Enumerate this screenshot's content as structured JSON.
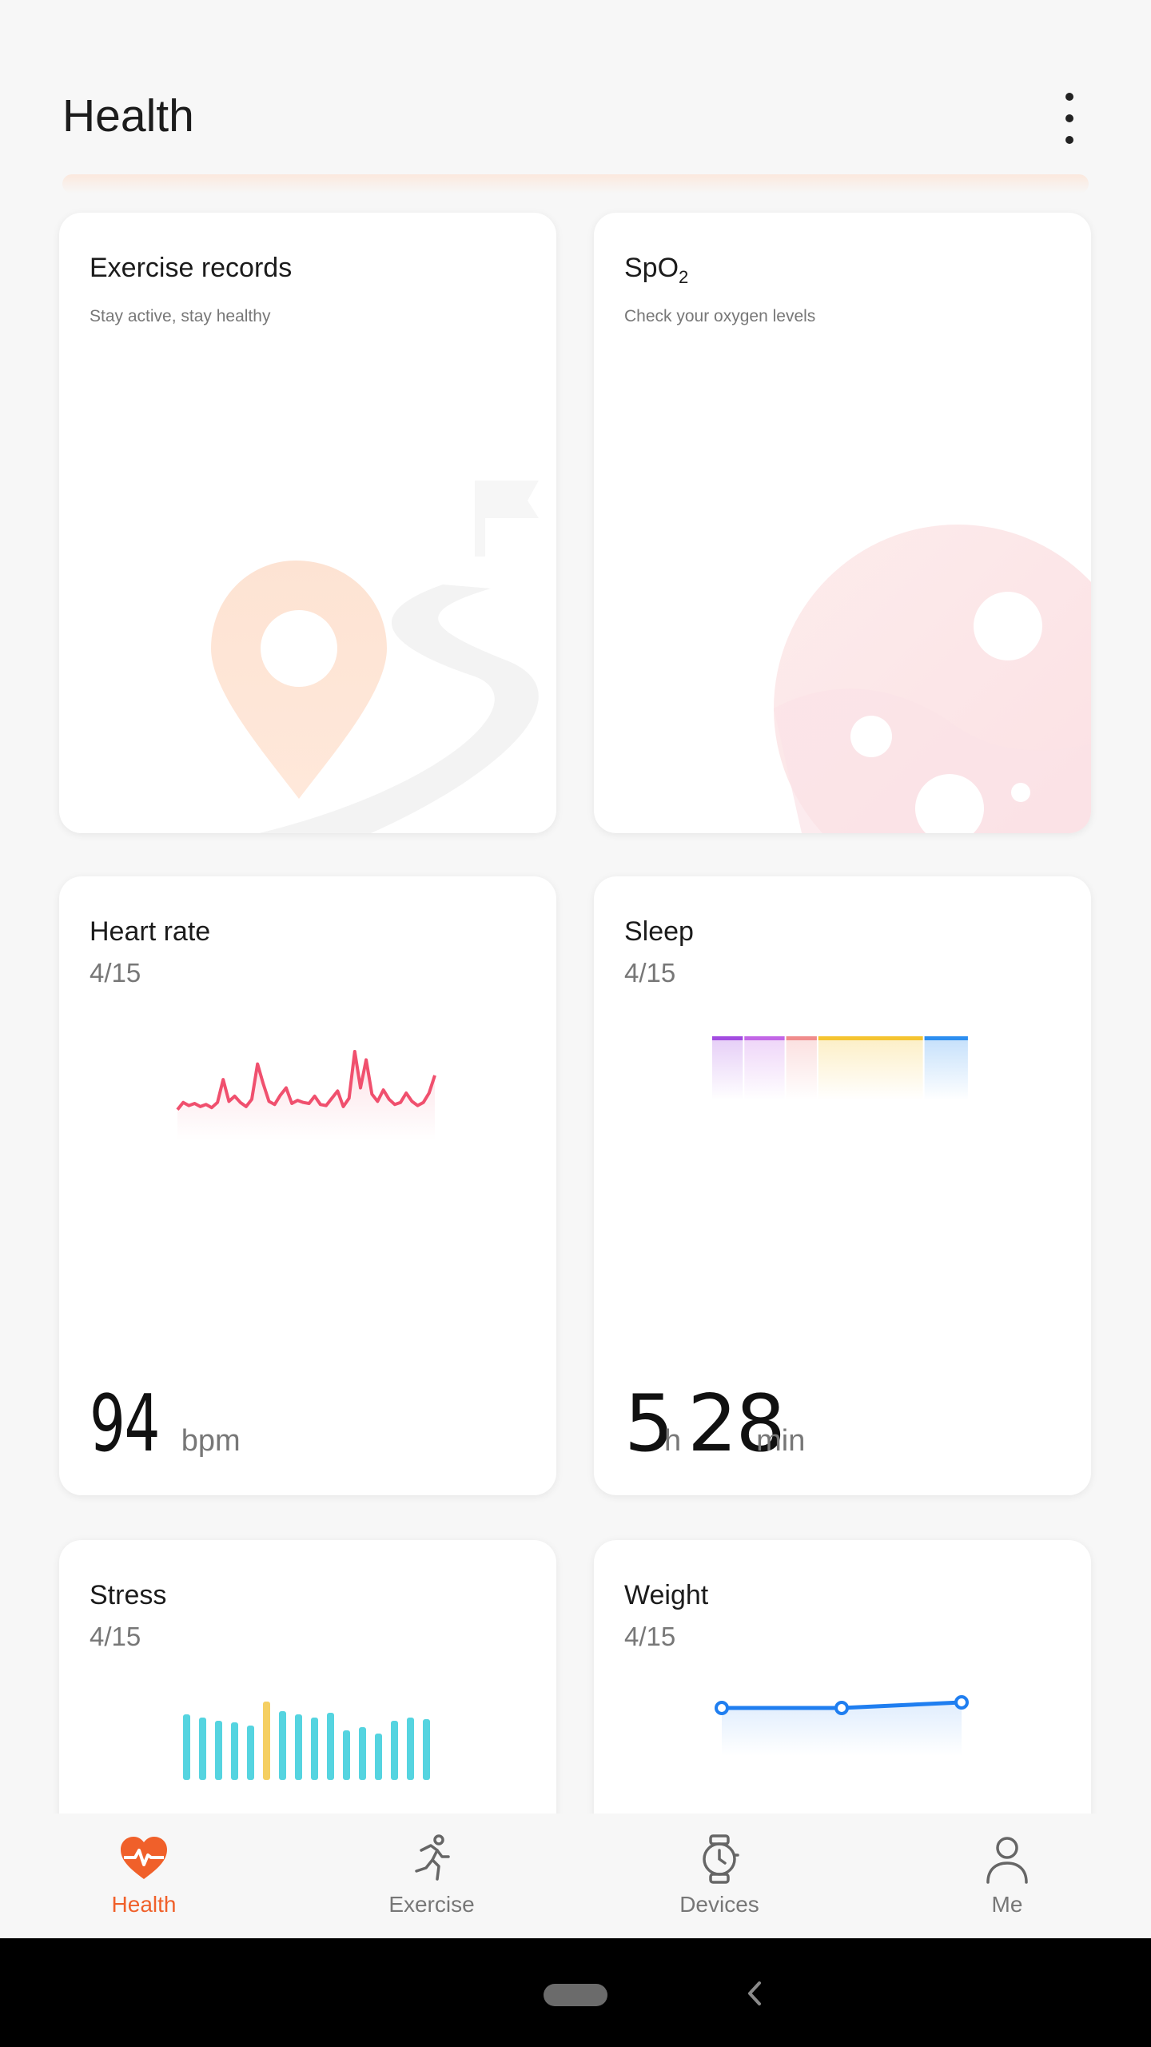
{
  "header": {
    "title": "Health"
  },
  "cards": {
    "exercise": {
      "title": "Exercise records",
      "subtitle": "Stay active, stay healthy"
    },
    "spo2": {
      "title_main": "SpO",
      "title_sub": "2",
      "subtitle": "Check your oxygen levels"
    },
    "heart_rate": {
      "title": "Heart rate",
      "date": "4/15",
      "value": "94",
      "unit": "bpm",
      "accent": "#f0506e",
      "samples": [
        14,
        21,
        18,
        20,
        17,
        19,
        16,
        21,
        43,
        22,
        27,
        21,
        17,
        24,
        58,
        39,
        22,
        19,
        28,
        35,
        20,
        23,
        21,
        20,
        27,
        19,
        18,
        25,
        32,
        17,
        25,
        70,
        35,
        62,
        29,
        22,
        33,
        24,
        19,
        21,
        30,
        22,
        18,
        21,
        30,
        47
      ]
    },
    "sleep": {
      "title": "Sleep",
      "date": "4/15",
      "hours": "5",
      "hours_unit": "h",
      "minutes": "28",
      "minutes_unit": "min",
      "stages": [
        {
          "color": "#a24be0",
          "weight": 1
        },
        {
          "color": "#c266e6",
          "weight": 1.3
        },
        {
          "color": "#f08c8c",
          "weight": 1
        },
        {
          "color": "#f5c430",
          "weight": 3.3
        },
        {
          "color": "#2c8ef0",
          "weight": 1.4
        }
      ]
    },
    "stress": {
      "title": "Stress",
      "date": "4/15",
      "accent": "#55d4e0",
      "highlight": "#f5cf62",
      "levels": [
        82,
        78,
        74,
        72,
        68,
        98,
        86,
        82,
        78,
        84,
        62,
        66,
        58,
        74,
        78,
        76
      ],
      "highlight_index": 5
    },
    "weight": {
      "title": "Weight",
      "date": "4/15",
      "accent": "#1f7ef0"
    }
  },
  "tabs": [
    {
      "label": "Health",
      "icon": "heart-pulse-icon",
      "active": true
    },
    {
      "label": "Exercise",
      "icon": "running-icon",
      "active": false
    },
    {
      "label": "Devices",
      "icon": "watch-icon",
      "active": false
    },
    {
      "label": "Me",
      "icon": "person-icon",
      "active": false
    }
  ],
  "colors": {
    "accent": "#f0602a",
    "background": "#f7f7f7"
  }
}
